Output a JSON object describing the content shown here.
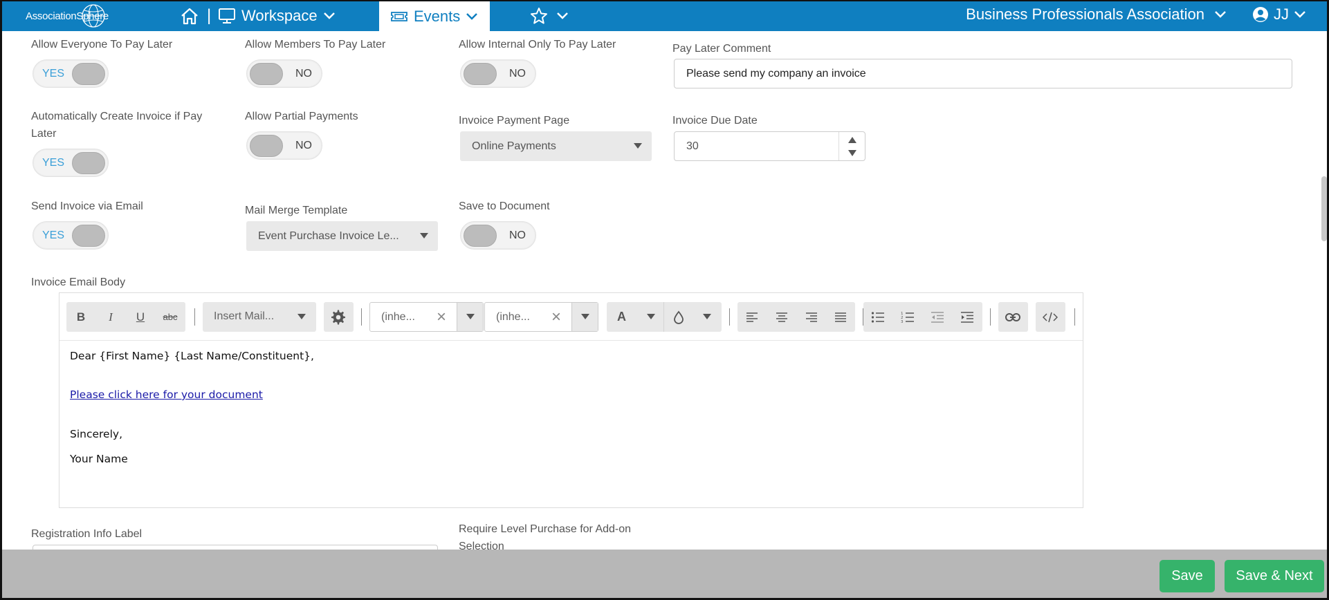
{
  "nav": {
    "logo_text": "AssociationSphere",
    "separator": "|",
    "workspace": "Workspace",
    "events": "Events",
    "organization": "Business Professionals Association",
    "user_initials": "JJ"
  },
  "fields": {
    "everyone_pay_later": {
      "label": "Allow Everyone To Pay Later",
      "value": "YES"
    },
    "members_pay_later": {
      "label": "Allow Members To Pay Later",
      "value": "NO"
    },
    "internal_pay_later": {
      "label": "Allow Internal Only To Pay Later",
      "value": "NO"
    },
    "pay_later_comment": {
      "label": "Pay Later Comment",
      "value": "Please send my company an invoice"
    },
    "auto_invoice": {
      "label_line1": "Automatically Create Invoice if Pay",
      "label_line2": "Later",
      "value": "YES"
    },
    "partial_payments": {
      "label": "Allow Partial Payments",
      "value": "NO"
    },
    "invoice_payment_page": {
      "label": "Invoice Payment Page",
      "value": "Online Payments"
    },
    "invoice_due_date": {
      "label": "Invoice Due Date",
      "value": "30"
    },
    "send_invoice_email": {
      "label": "Send Invoice via Email",
      "value": "YES"
    },
    "mail_merge_template": {
      "label": "Mail Merge Template",
      "value": "Event Purchase Invoice Le..."
    },
    "save_to_document": {
      "label": "Save to Document",
      "value": "NO"
    },
    "invoice_email_body": {
      "label": "Invoice Email Body"
    },
    "registration_info_label": {
      "label": "Registration Info Label"
    },
    "require_level_purchase": {
      "label_line1": "Require Level Purchase for Add-on",
      "label_line2": "Selection"
    }
  },
  "editor": {
    "toolbar": {
      "bold": "B",
      "italic": "I",
      "underline": "U",
      "strike": "abc",
      "insert_mail": "Insert Mail...",
      "font_family": "(inhe...",
      "font_size": "(inhe...",
      "font_color": "A",
      "clear": "×"
    },
    "body": {
      "greeting": "Dear {First Name} {Last Name/Constituent},",
      "link": "Please click here for your document",
      "closing": "Sincerely,",
      "signature": "Your Name"
    }
  },
  "footer": {
    "save": "Save",
    "save_next": "Save & Next"
  }
}
